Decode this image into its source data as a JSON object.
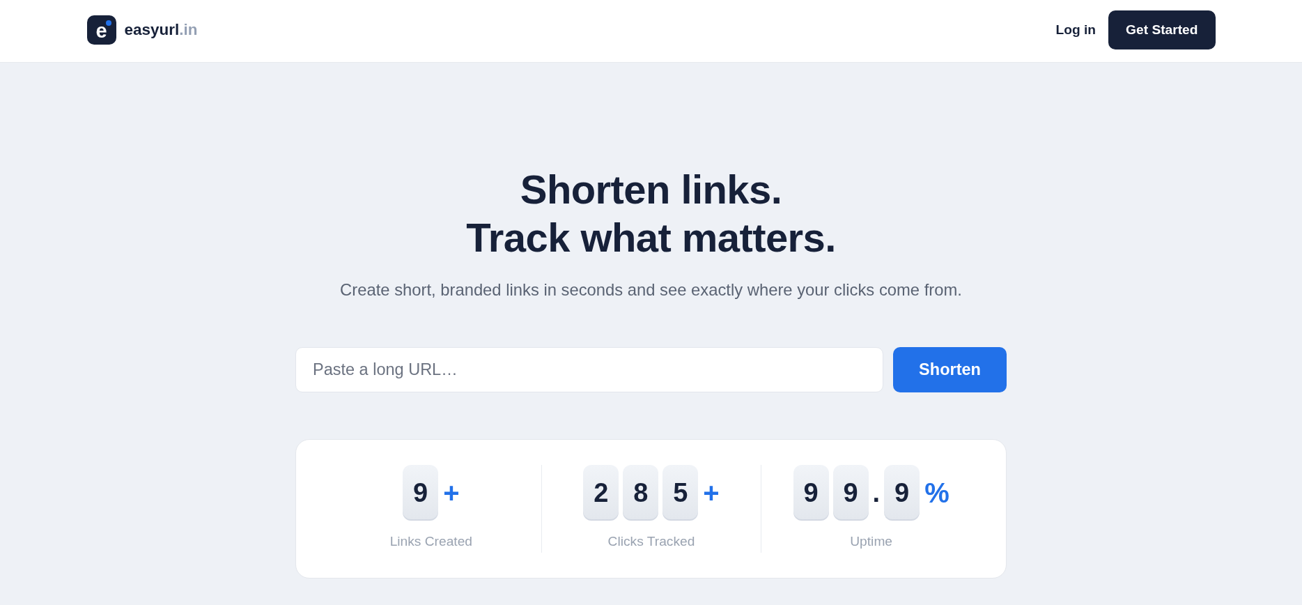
{
  "header": {
    "logo": {
      "mark": "e",
      "name": "easyurl",
      "suffix": ".in"
    },
    "nav": [
      {
        "label": "Log in",
        "kind": "link"
      },
      {
        "label": "Get Started",
        "kind": "button"
      }
    ]
  },
  "hero": {
    "title_lines": [
      "Shorten links.",
      "Track what matters."
    ],
    "subtitle": "Create short, branded links in seconds and see exactly where your clicks come from."
  },
  "shorten_form": {
    "placeholder": "Paste a long URL…",
    "button": "Shorten"
  },
  "stats": [
    {
      "chars": [
        {
          "char": "9",
          "kind": "digit"
        }
      ],
      "suffix": "+",
      "label": "Links Created"
    },
    {
      "chars": [
        {
          "char": "2",
          "kind": "digit"
        },
        {
          "char": "8",
          "kind": "digit"
        },
        {
          "char": "5",
          "kind": "digit"
        }
      ],
      "suffix": "+",
      "label": "Clicks Tracked"
    },
    {
      "chars": [
        {
          "char": "9",
          "kind": "digit"
        },
        {
          "char": "9",
          "kind": "digit"
        },
        {
          "char": ".",
          "kind": "point"
        },
        {
          "char": "9",
          "kind": "digit"
        }
      ],
      "suffix": "%",
      "label": "Uptime"
    }
  ]
}
